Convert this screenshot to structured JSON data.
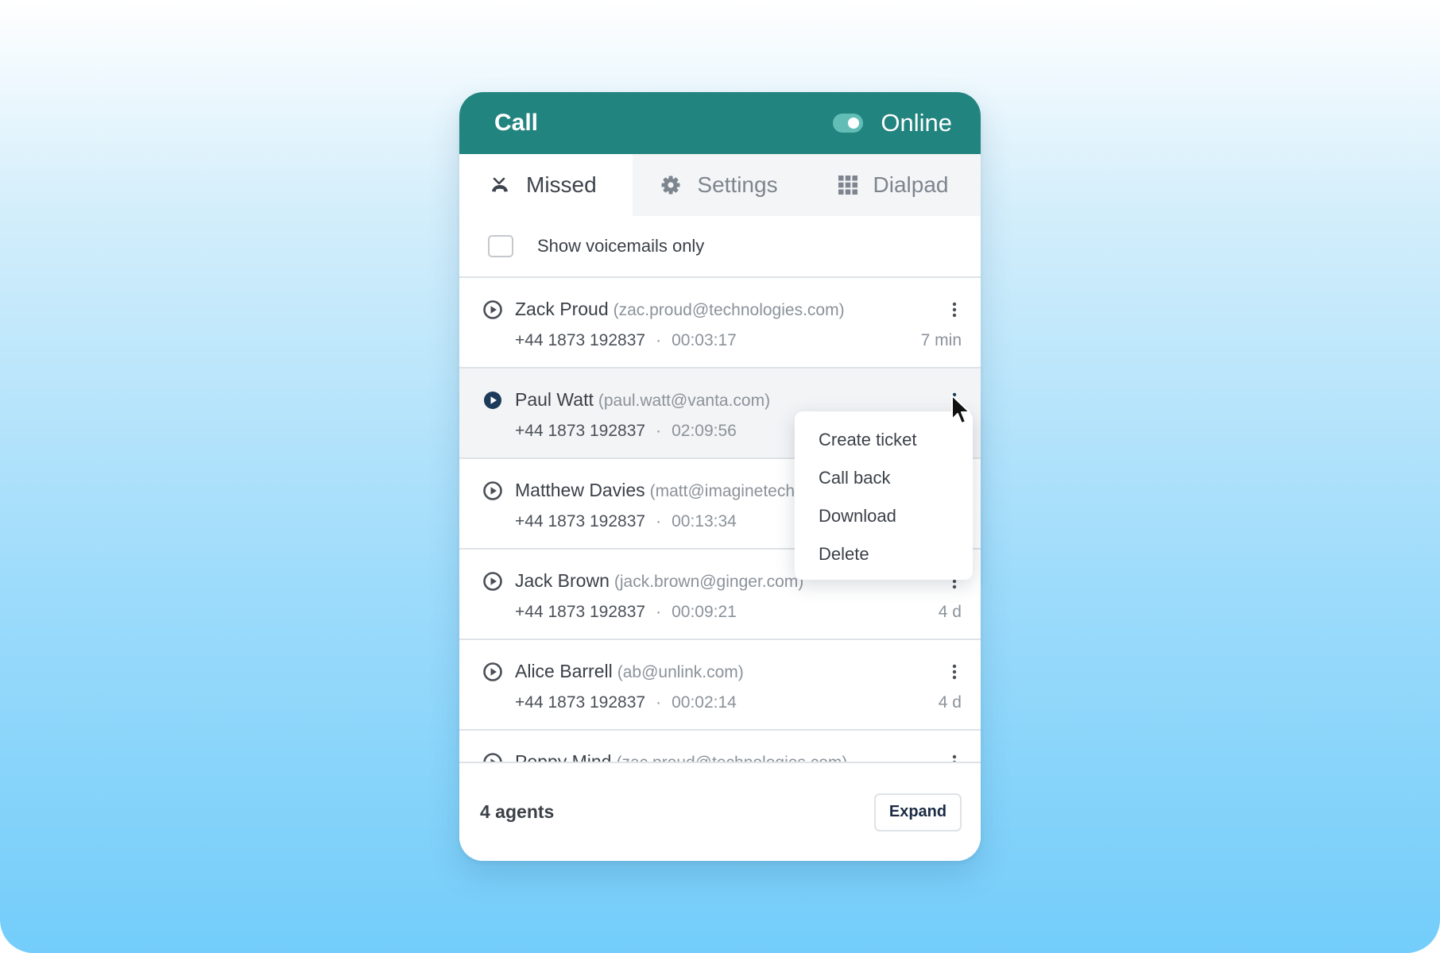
{
  "header": {
    "title": "Call",
    "status_label": "Online",
    "online": true
  },
  "tabs": [
    {
      "label": "Missed",
      "icon": "missed-call-icon",
      "active": true
    },
    {
      "label": "Settings",
      "icon": "gear-icon",
      "active": false
    },
    {
      "label": "Dialpad",
      "icon": "dialpad-icon",
      "active": false
    }
  ],
  "filter": {
    "label": "Show voicemails only",
    "checked": false
  },
  "calls": [
    {
      "name": "Zack Proud",
      "email": "(zac.proud@technologies.com)",
      "phone": "+44 1873 192837",
      "separator": "·",
      "duration": "00:03:17",
      "ago": "7 min"
    },
    {
      "name": "Paul Watt",
      "email": "(paul.watt@vanta.com)",
      "phone": "+44 1873 192837",
      "separator": "·",
      "duration": "02:09:56",
      "ago": ""
    },
    {
      "name": "Matthew Davies",
      "email": "(matt@imaginetech",
      "phone": "+44 1873 192837",
      "separator": "·",
      "duration": "00:13:34",
      "ago": ""
    },
    {
      "name": "Jack Brown",
      "email": "(jack.brown@ginger.com)",
      "phone": "+44 1873 192837",
      "separator": "·",
      "duration": "00:09:21",
      "ago": "4 d"
    },
    {
      "name": "Alice Barrell",
      "email": "(ab@unlink.com)",
      "phone": "+44 1873 192837",
      "separator": "·",
      "duration": "00:02:14",
      "ago": "4 d"
    },
    {
      "name": "Poppy Mind",
      "email": "(zac.proud@technologies.com)",
      "phone": "",
      "separator": "",
      "duration": "",
      "ago": ""
    }
  ],
  "context_menu": {
    "items": [
      "Create ticket",
      "Call back",
      "Download",
      "Delete"
    ]
  },
  "footer": {
    "agents_label": "4 agents",
    "expand_label": "Expand"
  },
  "colors": {
    "header_bg": "#21847e",
    "toggle_on": "#62bdb7",
    "play_active": "#1c3a5a",
    "play_default": "#4a4f57"
  }
}
